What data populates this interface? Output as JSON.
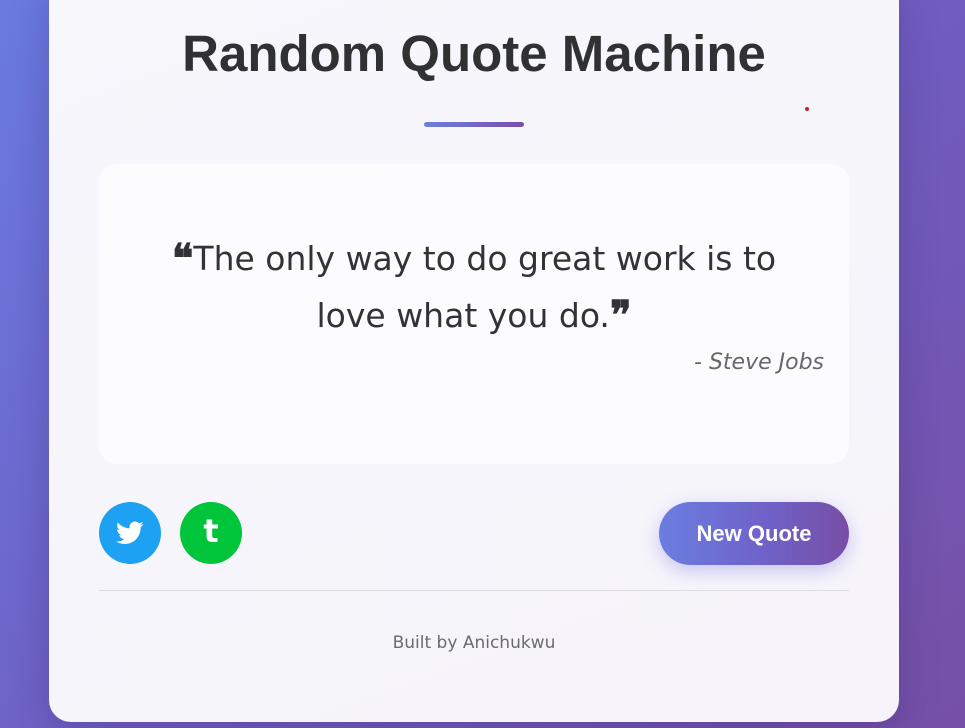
{
  "header": {
    "title": "Random Quote Machine"
  },
  "quote": {
    "open_mark": "❝",
    "text": "The only way to do great work is to love what you do.",
    "close_mark": "❞",
    "author": "- Steve Jobs"
  },
  "actions": {
    "twitter_icon": "twitter-icon",
    "tumblr_icon": "tumblr-icon",
    "tumblr_glyph": "t",
    "new_quote_label": "New Quote"
  },
  "footer": {
    "credit": "Built by Anichukwu"
  },
  "colors": {
    "accent_start": "#6b7ee0",
    "accent_end": "#774ea6",
    "twitter": "#1da1f2",
    "tumblr": "#00c43a"
  }
}
